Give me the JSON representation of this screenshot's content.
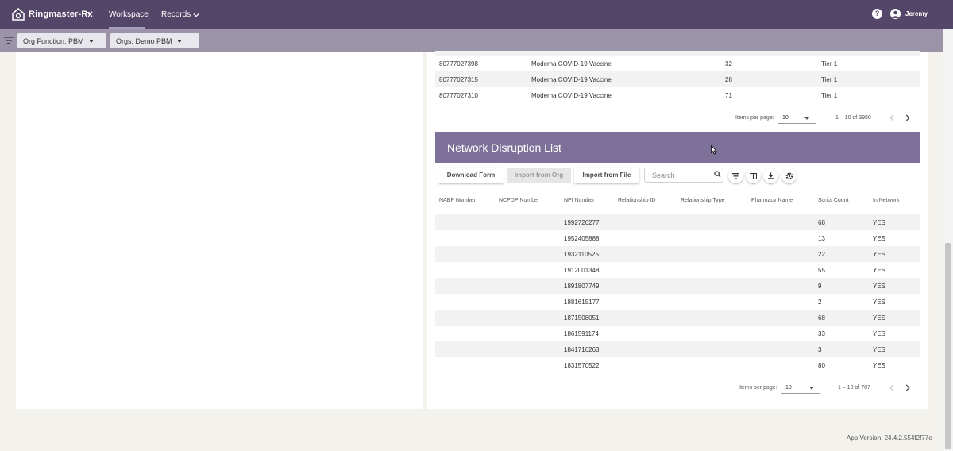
{
  "topbar": {
    "logo_text": "Ringmaster-Rx",
    "nav": {
      "workspace": "Workspace",
      "records": "Records"
    },
    "help_label": "?",
    "user_name": "Jeremy",
    "bg_color": "#534668"
  },
  "subbar": {
    "org_function": "Org Function: PBM",
    "orgs": "Orgs: Demo PBM"
  },
  "top_table": {
    "rows": [
      {
        "id": "80777027398",
        "name": "Moderna COVID-19 Vaccine",
        "count": "32",
        "tier": "Tier 1"
      },
      {
        "id": "80777027315",
        "name": "Moderna COVID-19 Vaccine",
        "count": "28",
        "tier": "Tier 1"
      },
      {
        "id": "80777027310",
        "name": "Moderna COVID-19 Vaccine",
        "count": "71",
        "tier": "Tier 1"
      }
    ],
    "pager": {
      "label": "Items per page:",
      "size": "10",
      "range": "1 – 10 of 3950"
    }
  },
  "ndl": {
    "title": "Network Disruption List",
    "buttons": {
      "download": "Download Form",
      "import_org": "Import from Org",
      "import_file": "Import from File"
    },
    "search_placeholder": "Search",
    "columns": [
      "NABP Number",
      "NCPDP Number",
      "NPI Number",
      "Relationship ID",
      "Relationship Type",
      "Pharmacy Name",
      "Script Count",
      "In Network"
    ],
    "rows": [
      {
        "npi": "1992726277",
        "count": "68",
        "in_network": "YES"
      },
      {
        "npi": "1952405888",
        "count": "13",
        "in_network": "YES"
      },
      {
        "npi": "1932110525",
        "count": "22",
        "in_network": "YES"
      },
      {
        "npi": "1912001348",
        "count": "55",
        "in_network": "YES"
      },
      {
        "npi": "1891807749",
        "count": "9",
        "in_network": "YES"
      },
      {
        "npi": "1881615177",
        "count": "2",
        "in_network": "YES"
      },
      {
        "npi": "1871508051",
        "count": "68",
        "in_network": "YES"
      },
      {
        "npi": "1861591174",
        "count": "33",
        "in_network": "YES"
      },
      {
        "npi": "1841716263",
        "count": "3",
        "in_network": "YES"
      },
      {
        "npi": "1831570522",
        "count": "80",
        "in_network": "YES"
      }
    ],
    "pager": {
      "label": "Items per page:",
      "size": "10",
      "range": "1 – 10 of 787"
    }
  },
  "footer": {
    "version": "App Version: 24.4.2.554f2f77e"
  }
}
